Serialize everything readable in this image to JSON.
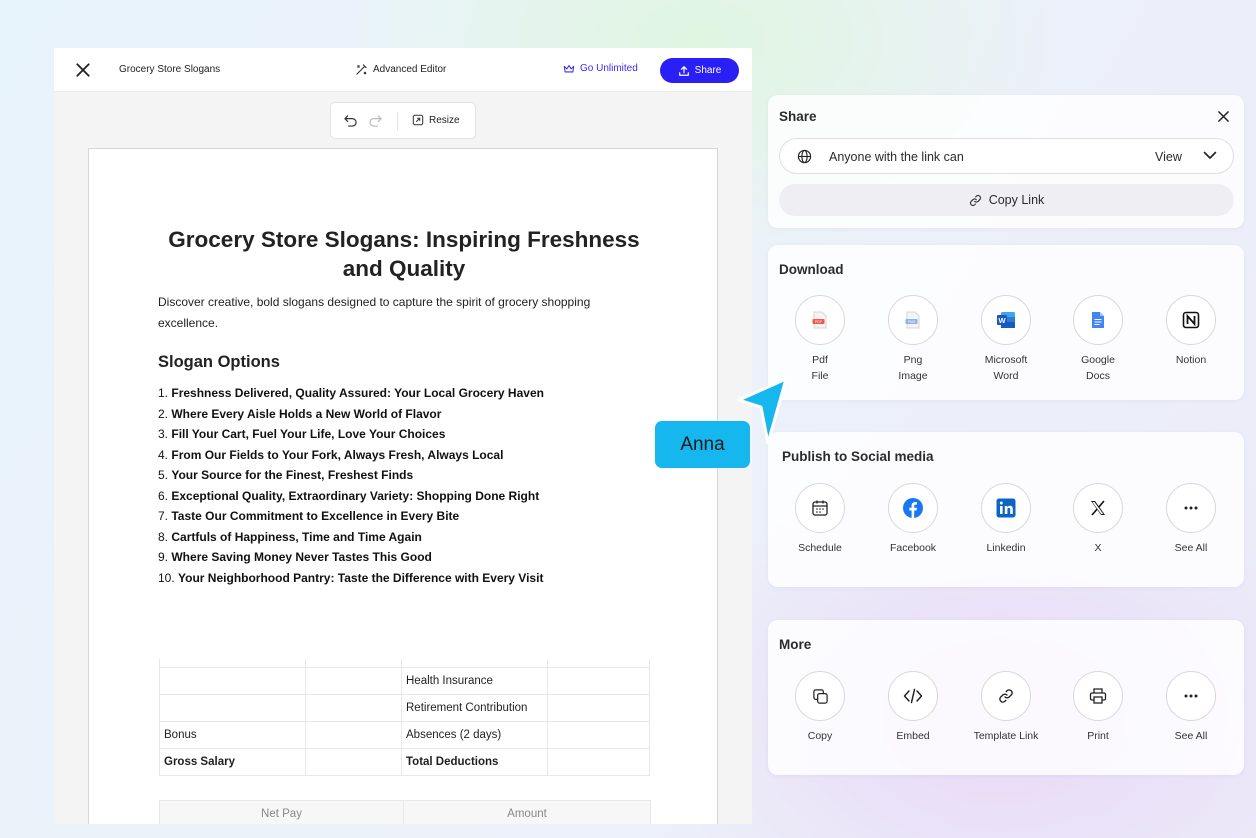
{
  "editor": {
    "doc_title": "Grocery Store Slogans",
    "advanced_editor": "Advanced Editor",
    "go_unlimited": "Go Unlimited",
    "share": "Share",
    "resize": "Resize"
  },
  "document": {
    "title": "Grocery Store Slogans: Inspiring Freshness and Quality",
    "intro": "Discover creative, bold slogans designed to capture the spirit of grocery shopping excellence.",
    "section_heading": "Slogan Options",
    "slogans": [
      {
        "num": "1.",
        "text": "Freshness Delivered, Quality Assured: Your Local Grocery Haven"
      },
      {
        "num": "2.",
        "text": "Where Every Aisle Holds a New World of Flavor"
      },
      {
        "num": "3.",
        "text": "Fill Your Cart, Fuel Your Life, Love Your Choices"
      },
      {
        "num": "4.",
        "text": "From Our Fields to Your Fork, Always Fresh, Always Local"
      },
      {
        "num": "5.",
        "text": "Your Source for the Finest, Freshest Finds"
      },
      {
        "num": "6.",
        "text": "Exceptional Quality, Extraordinary Variety: Shopping Done Right"
      },
      {
        "num": "7.",
        "text": "Taste Our Commitment to Excellence in Every Bite"
      },
      {
        "num": "8.",
        "text": "Cartfuls of Happiness, Time and Time Again"
      },
      {
        "num": "9.",
        "text": "Where Saving Money Never Tastes This Good"
      },
      {
        "num": "10.",
        "text": "Your Neighborhood Pantry: Taste the Difference with Every Visit"
      }
    ],
    "table_rows": [
      [
        "",
        "",
        "",
        ""
      ],
      [
        "",
        "",
        "Health Insurance",
        ""
      ],
      [
        "",
        "",
        "Retirement Contribution",
        ""
      ],
      [
        "Bonus",
        "",
        "Absences (2 days)",
        ""
      ],
      [
        "Gross Salary",
        "",
        "Total Deductions",
        ""
      ]
    ],
    "net_table": [
      "Net Pay",
      "Amount"
    ]
  },
  "share_panel": {
    "title": "Share",
    "permission_text": "Anyone with the link can",
    "permission_value": "View",
    "copy_link": "Copy Link"
  },
  "download": {
    "title": "Download",
    "options": [
      {
        "line1": "Pdf",
        "line2": "File",
        "icon": "pdf-file-icon"
      },
      {
        "line1": "Png",
        "line2": "Image",
        "icon": "png-image-icon"
      },
      {
        "line1": "Microsoft",
        "line2": "Word",
        "icon": "microsoft-word-icon"
      },
      {
        "line1": "Google",
        "line2": "Docs",
        "icon": "google-docs-icon"
      },
      {
        "line1": "Notion",
        "line2": "",
        "icon": "notion-icon"
      }
    ]
  },
  "social": {
    "title": "Publish to Social media",
    "options": [
      {
        "label": "Schedule",
        "icon": "calendar-icon"
      },
      {
        "label": "Facebook",
        "icon": "facebook-icon"
      },
      {
        "label": "Linkedin",
        "icon": "linkedin-icon"
      },
      {
        "label": "X",
        "icon": "x-icon"
      },
      {
        "label": "See All",
        "icon": "more-icon"
      }
    ]
  },
  "more": {
    "title": "More",
    "options": [
      {
        "label": "Copy",
        "icon": "copy-icon"
      },
      {
        "label": "Embed",
        "icon": "code-icon"
      },
      {
        "label": "Template Link",
        "icon": "link-icon"
      },
      {
        "label": "Print",
        "icon": "printer-icon"
      },
      {
        "label": "See All",
        "icon": "more-icon"
      }
    ]
  },
  "collaborator": {
    "name": "Anna"
  },
  "colors": {
    "accent": "#2a1ff5",
    "collaborator": "#16b7ee",
    "word": "#185abd",
    "docs": "#4285f4",
    "facebook": "#1877f2",
    "linkedin": "#0a66c2"
  }
}
